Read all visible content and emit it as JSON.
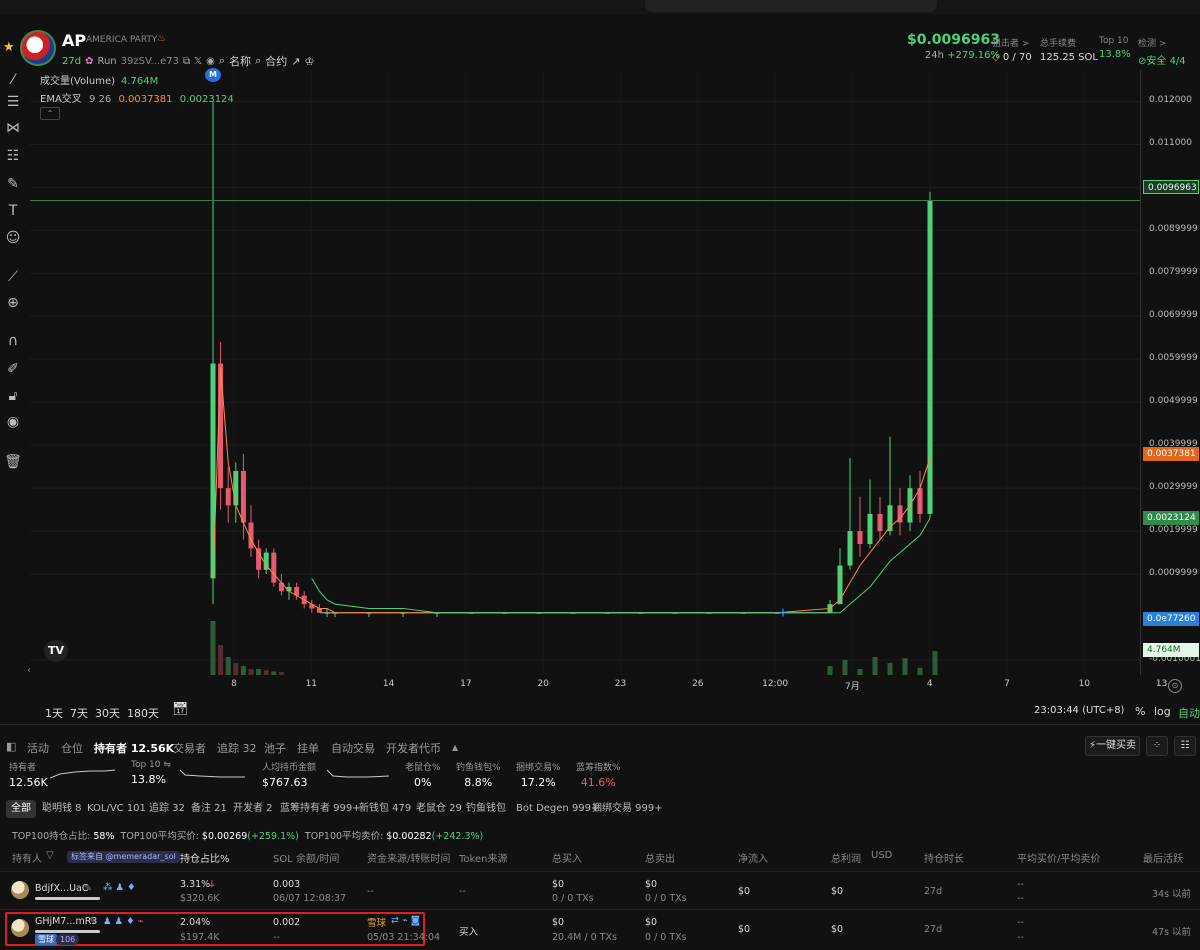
{
  "token": {
    "ticker": "AP",
    "full_name": "AMERICA PARTY",
    "age": "27d",
    "status": "Run",
    "address": "39zSV...e73",
    "name_label": "名称",
    "contract_label": "合约"
  },
  "price": {
    "value": "$0.0096963",
    "change_label": "24h",
    "change": "+279.16%"
  },
  "stats": {
    "snipers_label": "狙击者 >",
    "snipers_value": "0 / 70",
    "fees_label": "总手续费",
    "fees_value": "125.25 SOL",
    "top10_label": "Top 10",
    "top10_value": "13.8%",
    "check_label": "检测 >",
    "check_value": "安全 4/4"
  },
  "chart_legend": {
    "volume_label": "成交量(Volume)",
    "volume_value": "4.764M",
    "ema_label": "EMA交叉",
    "ema_params": "9 26",
    "ema_fast": "0.0037381",
    "ema_slow": "0.0023124",
    "marker": "M"
  },
  "chart_data": {
    "type": "candlestick",
    "y_ticks": [
      "0.012000",
      "0.011000",
      "0.0099999",
      "0.0089999",
      "0.0079999",
      "0.0069999",
      "0.0059999",
      "0.0049999",
      "0.0039999",
      "0.0029999",
      "0.0019999",
      "0.0009999",
      "-0.0010001"
    ],
    "x_ticks": [
      "8",
      "11",
      "14",
      "17",
      "20",
      "23",
      "26",
      "12:00",
      "7月",
      "4",
      "7",
      "10",
      "13"
    ],
    "price_tags": {
      "current": "0.0096963",
      "ema_fast": "0.0037381",
      "ema_slow": "0.0023124",
      "low": "0.0e77260",
      "volume": "4.764M"
    },
    "candles": [
      [
        0.0009,
        0.0059,
        0.012,
        0.0003
      ],
      [
        0.0059,
        0.003,
        0.0064,
        0.0025
      ],
      [
        0.003,
        0.0026,
        0.0035,
        0.0022
      ],
      [
        0.0026,
        0.0034,
        0.0036,
        0.0022
      ],
      [
        0.0034,
        0.0022,
        0.0038,
        0.0018
      ],
      [
        0.0022,
        0.0016,
        0.0026,
        0.0014
      ],
      [
        0.0016,
        0.0011,
        0.0018,
        0.0009
      ],
      [
        0.0011,
        0.0015,
        0.0016,
        0.001
      ],
      [
        0.0015,
        0.0008,
        0.0016,
        0.0007
      ],
      [
        0.0008,
        0.0006,
        0.001,
        0.0005
      ],
      [
        0.0006,
        0.0007,
        0.0008,
        0.0004
      ],
      [
        0.0007,
        0.0005,
        0.0008,
        0.0004
      ],
      [
        0.0005,
        0.0003,
        0.0006,
        0.0002
      ],
      [
        0.0003,
        0.0002,
        0.0004,
        0.0001
      ],
      [
        0.0002,
        0.0001,
        0.0003,
        0.0001
      ],
      [
        0.0001,
        0.0001,
        0.0002,
        0.0
      ],
      [
        0.0001,
        0.0001,
        0.0001,
        0.0
      ],
      [
        0.0001,
        0.0001,
        0.0001,
        0.0
      ],
      [
        0.0001,
        0.0001,
        0.0001,
        0.0
      ],
      [
        0.0001,
        0.0001,
        0.0001,
        0.0
      ],
      [
        0.0001,
        0.0001,
        0.0001,
        0.0001
      ],
      [
        0.0001,
        0.0001,
        0.0001,
        0.0001
      ],
      [
        0.0001,
        0.0001,
        0.0001,
        0.0001
      ],
      [
        0.0001,
        0.0001,
        0.0001,
        0.0001
      ],
      [
        0.0001,
        0.0001,
        0.0001,
        0.0001
      ],
      [
        0.0001,
        0.0001,
        0.0001,
        0.0001
      ],
      [
        0.0001,
        0.0001,
        0.0001,
        0.0001
      ],
      [
        0.0001,
        0.0001,
        0.0001,
        0.0001
      ],
      [
        0.0001,
        0.0001,
        0.0001,
        0.0001
      ],
      [
        0.0001,
        0.0001,
        0.0001,
        0.0001
      ],
      [
        0.0001,
        0.0003,
        0.0004,
        0.0001
      ],
      [
        0.0003,
        0.0012,
        0.0016,
        0.0003
      ],
      [
        0.0012,
        0.002,
        0.0037,
        0.0011
      ],
      [
        0.002,
        0.0017,
        0.0028,
        0.0014
      ],
      [
        0.0017,
        0.0024,
        0.0032,
        0.0016
      ],
      [
        0.0024,
        0.002,
        0.0028,
        0.0018
      ],
      [
        0.002,
        0.0026,
        0.0042,
        0.0019
      ],
      [
        0.0026,
        0.0022,
        0.003,
        0.0019
      ],
      [
        0.0022,
        0.003,
        0.0033,
        0.002
      ],
      [
        0.003,
        0.0024,
        0.0034,
        0.0022
      ],
      [
        0.0024,
        0.0097,
        0.0099,
        0.0023
      ]
    ],
    "ema_fast": [
      0.0009,
      0.0058,
      0.0036,
      0.0026,
      0.0022,
      0.0018,
      0.0015,
      0.0012,
      0.001,
      0.0008,
      0.0006,
      0.0005,
      0.0004,
      0.0003,
      0.0002,
      0.0002,
      0.0001,
      0.0001,
      0.0001,
      0.0001,
      0.0001,
      0.0001,
      0.0001,
      0.0001,
      0.0001,
      0.0001,
      0.0001,
      0.0001,
      0.0001,
      0.0001,
      0.0002,
      0.0004,
      0.0008,
      0.0012,
      0.0015,
      0.0018,
      0.0021,
      0.0023,
      0.0026,
      0.003,
      0.0037
    ],
    "ema_slow": [
      null,
      null,
      null,
      null,
      null,
      null,
      null,
      null,
      null,
      null,
      null,
      null,
      null,
      0.0009,
      0.0006,
      0.0004,
      0.0003,
      0.0002,
      0.0002,
      0.0001,
      0.0001,
      0.0001,
      0.0001,
      0.0001,
      0.0001,
      0.0001,
      0.0001,
      0.0001,
      0.0001,
      0.0001,
      0.0001,
      0.0001,
      0.0003,
      0.0005,
      0.0007,
      0.001,
      0.0013,
      0.0015,
      0.0017,
      0.0019,
      0.0023
    ],
    "ylim": [
      -0.0010001,
      0.0125
    ]
  },
  "time_ranges": [
    "1天",
    "7天",
    "30天",
    "180天"
  ],
  "clock": "23:03:44 (UTC+8)",
  "chart_options": [
    "%",
    "log",
    "自动"
  ],
  "tabs": [
    {
      "label": "活动"
    },
    {
      "label": "仓位"
    },
    {
      "label": "持有者 12.56K"
    },
    {
      "label": "交易者"
    },
    {
      "label": "追踪 32"
    },
    {
      "label": "池子"
    },
    {
      "label": "挂单"
    },
    {
      "label": "自动交易"
    },
    {
      "label": "开发者代币"
    }
  ],
  "quick_buy_label": "一键买卖",
  "kpis": {
    "holders_label": "持有者",
    "holders_value": "12.56K",
    "top10_label": "Top 10 ⇋",
    "top10_value": "13.8%",
    "avg_label": "人均持币金额",
    "avg_value": "$767.63",
    "rat_label": "老鼠仓%",
    "rat_value": "0%",
    "fish_label": "钓鱼钱包%",
    "fish_value": "8.8%",
    "bundle_label": "捆绑交易%",
    "bundle_value": "17.2%",
    "blue_label": "蓝筹指数%",
    "blue_value": "41.6%"
  },
  "filters": [
    "全部",
    "聪明钱 8",
    "KOL/VC 101",
    "追踪 32",
    "备注 21",
    "开发者 2",
    "蓝筹持有者 999+",
    "新钱包 479",
    "老鼠仓 29",
    "钓鱼钱包",
    "Bot Degen 999+",
    "捆绑交易 999+"
  ],
  "summary": {
    "share_label": "TOP100持仓占比:",
    "share_value": "58%",
    "avg_buy_label": "TOP100平均买价:",
    "avg_buy_value": "$0.00269",
    "avg_buy_change": "(+259.1%)",
    "avg_sell_label": "TOP100平均卖价:",
    "avg_sell_value": "$0.00282",
    "avg_sell_change": "(+242.3%)"
  },
  "table": {
    "headers": [
      "持有人",
      "持仓占比%",
      "SOL 余额/时间",
      "资金来源/转账时间",
      "Token来源",
      "总买入",
      "总卖出",
      "净流入",
      "总利润",
      "USD",
      "持仓时长",
      "平均买价/平均卖价",
      "最后活跃"
    ],
    "tag_source": "标签来自 @memeradar_sol",
    "rows": [
      {
        "wallet": "BdjfX...UaC",
        "pct": "3.31%",
        "usd": "$320.6K",
        "sol": "0.003",
        "sol_time": "06/07 12:08:37",
        "source": "--",
        "token_source": "--",
        "buy": "$0",
        "buy_txs": "0 / 0 TXs",
        "sell": "$0",
        "sell_txs": "0 / 0 TXs",
        "net": "$0",
        "profit": "$0",
        "hold": "27d",
        "avg1": "--",
        "avg2": "--",
        "last": "34s 以前"
      },
      {
        "wallet": "GHjM7...mR3",
        "badge": "雪球",
        "count": "106",
        "pct": "2.04%",
        "usd": "$197.4K",
        "sol": "0.002",
        "sol_time": "--",
        "source": "雪球",
        "source_time": "05/03 21:34:04",
        "token_source": "买入",
        "buy": "$0",
        "buy_txs": "20.4M / 0 TXs",
        "sell": "$0",
        "sell_txs": "0 / 0 TXs",
        "net": "$0",
        "profit": "$0",
        "hold": "27d",
        "avg1": "--",
        "avg2": "--",
        "last": "47s 以前"
      }
    ]
  },
  "colors": {
    "up": "#4fd17a",
    "down": "#e85a6f",
    "ema_fast": "#ff8a3c",
    "ema_slow": "#4fd17a",
    "accent": "#e01e1e"
  }
}
